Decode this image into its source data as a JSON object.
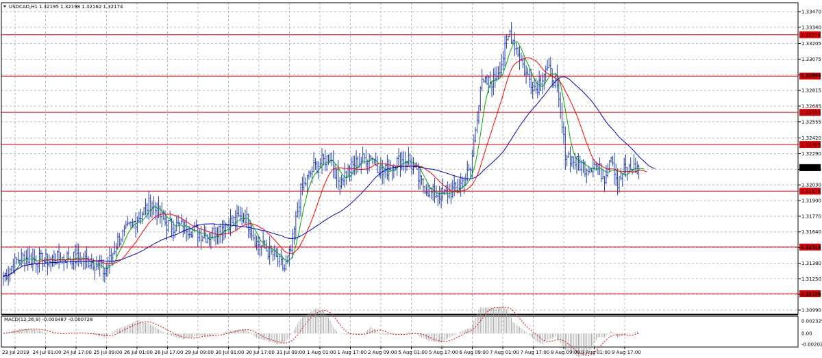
{
  "window": {
    "title_symbol": "USDCAD,H1",
    "ohlc": "1.32195 1.32198 1.32162 1.32174"
  },
  "chart_data": {
    "type": "candlestick",
    "symbol": "USDCAD",
    "timeframe": "H1",
    "background": "#ffffff",
    "grid": true,
    "y_ticks": [
      "1.33470",
      "1.33340",
      "1.33205",
      "1.33075",
      "1.32945",
      "1.32815",
      "1.32685",
      "1.32555",
      "1.32420",
      "1.32290",
      "1.32160",
      "1.32030",
      "1.31900",
      "1.31770",
      "1.31640",
      "1.31510",
      "1.31380",
      "1.31250",
      "1.31120",
      "1.30990"
    ],
    "ylim": [
      1.3099,
      1.3347
    ],
    "x_ticks": [
      "23 Jul 2019",
      "24 Jul 01:00",
      "24 Jul 17:00",
      "25 Jul 09:00",
      "26 Jul 01:00",
      "26 Jul 17:00",
      "29 Jul 09:00",
      "30 Jul 01:00",
      "30 Jul 17:00",
      "31 Jul 09:00",
      "1 Aug 01:00",
      "1 Aug 17:00",
      "2 Aug 09:00",
      "5 Aug 01:00",
      "5 Aug 17:00",
      "6 Aug 09:00",
      "7 Aug 01:00",
      "7 Aug 17:00",
      "8 Aug 09:00",
      "9 Aug 01:00",
      "9 Aug 17:00"
    ],
    "levels": [
      {
        "label": "1.33278",
        "value": 1.33278
      },
      {
        "label": "1.32934",
        "value": 1.32934
      },
      {
        "label": "1.32633",
        "value": 1.32633
      },
      {
        "label": "1.32366",
        "value": 1.32366
      },
      {
        "label": "1.31978",
        "value": 1.31978
      },
      {
        "label": "1.31514",
        "value": 1.31514
      },
      {
        "label": "1.31126",
        "value": 1.31126
      }
    ],
    "current_price": {
      "label": "1.32174",
      "value": 1.32174
    },
    "series_anchors": [
      {
        "i": 0,
        "v": 1.3127
      },
      {
        "i": 10,
        "v": 1.3143
      },
      {
        "i": 25,
        "v": 1.314
      },
      {
        "i": 40,
        "v": 1.3143
      },
      {
        "i": 55,
        "v": 1.3139
      },
      {
        "i": 62,
        "v": 1.313
      },
      {
        "i": 70,
        "v": 1.3157
      },
      {
        "i": 80,
        "v": 1.3172
      },
      {
        "i": 90,
        "v": 1.3188
      },
      {
        "i": 100,
        "v": 1.317
      },
      {
        "i": 112,
        "v": 1.3168
      },
      {
        "i": 125,
        "v": 1.316
      },
      {
        "i": 135,
        "v": 1.317
      },
      {
        "i": 148,
        "v": 1.3177
      },
      {
        "i": 155,
        "v": 1.3155
      },
      {
        "i": 165,
        "v": 1.3145
      },
      {
        "i": 172,
        "v": 1.3133
      },
      {
        "i": 176,
        "v": 1.3148
      },
      {
        "i": 182,
        "v": 1.3198
      },
      {
        "i": 190,
        "v": 1.3217
      },
      {
        "i": 200,
        "v": 1.3227
      },
      {
        "i": 205,
        "v": 1.3206
      },
      {
        "i": 215,
        "v": 1.322
      },
      {
        "i": 225,
        "v": 1.3228
      },
      {
        "i": 232,
        "v": 1.3212
      },
      {
        "i": 240,
        "v": 1.3222
      },
      {
        "i": 248,
        "v": 1.3225
      },
      {
        "i": 255,
        "v": 1.3205
      },
      {
        "i": 262,
        "v": 1.3196
      },
      {
        "i": 270,
        "v": 1.3195
      },
      {
        "i": 278,
        "v": 1.32
      },
      {
        "i": 286,
        "v": 1.3215
      },
      {
        "i": 292,
        "v": 1.3285
      },
      {
        "i": 300,
        "v": 1.329
      },
      {
        "i": 305,
        "v": 1.3305
      },
      {
        "i": 310,
        "v": 1.333
      },
      {
        "i": 316,
        "v": 1.331
      },
      {
        "i": 320,
        "v": 1.3295
      },
      {
        "i": 326,
        "v": 1.3283
      },
      {
        "i": 332,
        "v": 1.33
      },
      {
        "i": 338,
        "v": 1.329
      },
      {
        "i": 344,
        "v": 1.323
      },
      {
        "i": 350,
        "v": 1.3222
      },
      {
        "i": 356,
        "v": 1.3218
      },
      {
        "i": 362,
        "v": 1.322
      },
      {
        "i": 368,
        "v": 1.321
      },
      {
        "i": 372,
        "v": 1.323
      },
      {
        "i": 376,
        "v": 1.3203
      },
      {
        "i": 380,
        "v": 1.3215
      },
      {
        "i": 386,
        "v": 1.3217
      }
    ],
    "moving_averages": [
      {
        "color": "#00aa00",
        "period": 8
      },
      {
        "color": "#ff0000",
        "period": 21
      },
      {
        "color": "#0000cc",
        "period": 55
      }
    ],
    "candle_color": "#1f3fbf",
    "macd": {
      "label": "MACD(12,26,9) -0.000487 -0.000728",
      "y_ticks": [
        "0.002329",
        "0.00",
        "-0.002027"
      ],
      "ylim": [
        -0.002027,
        0.002329
      ]
    }
  }
}
